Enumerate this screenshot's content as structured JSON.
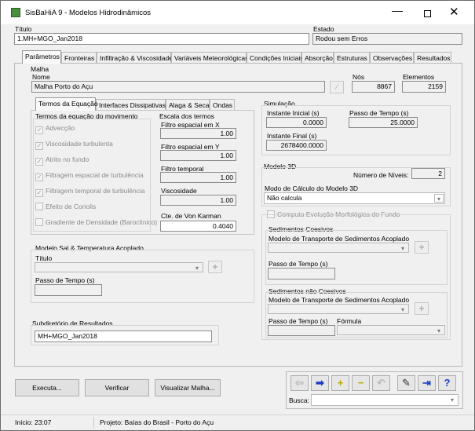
{
  "window": {
    "title": "SisBaHiA 9 - Modelos Hidrodinâmicos"
  },
  "header": {
    "titulo_label": "Título",
    "titulo_value": "1.MH+MGO_Jan2018",
    "estado_label": "Estado",
    "estado_value": "Rodou sem Erros"
  },
  "tabs": [
    "Parâmetros",
    "Fronteiras",
    "Infiltração & Viscosidade",
    "Variáveis Meteorológicas",
    "Condições Iniciais",
    "Absorção",
    "Estruturas",
    "Observações",
    "Resultados"
  ],
  "malha": {
    "group_label": "Malha",
    "nome_label": "Nome",
    "nome_value": "Malha Porto do Açu",
    "nos_label": "Nós",
    "nos_value": "8867",
    "elementos_label": "Elementos",
    "elementos_value": "2159"
  },
  "subtabs": [
    "Termos da Equação",
    "Interfaces Dissipativas",
    "Alaga & Seca",
    "Ondas"
  ],
  "termos": {
    "group_label": "Termos da equação do movimento",
    "items": [
      "Advecção",
      "Viscosidade turbulenta",
      "Atrito no fundo",
      "Filtragem espacial de turbulência",
      "Filtragem temporal de turbulência",
      "Efeito de Coriolis",
      "Gradiente de Densidade (Baroclínico)"
    ],
    "checked": [
      true,
      true,
      true,
      true,
      true,
      false,
      false
    ]
  },
  "escala": {
    "group_label": "Escala dos termos",
    "filtro_x_label": "Filtro espacial em X",
    "filtro_x": "1.00",
    "filtro_y_label": "Filtro espacial em Y",
    "filtro_y": "1.00",
    "filtro_t_label": "Filtro temporal",
    "filtro_t": "1.00",
    "visc_label": "Viscosidade",
    "visc": "1.00",
    "karman_label": "Cte. de Von Karman",
    "karman": "0.4040"
  },
  "sal": {
    "group_label": "Modelo Sal & Temperatura Acoplado",
    "titulo_label": "Título",
    "passo_label": "Passo de Tempo (s)"
  },
  "subdir": {
    "label": "Subdiretório de Resultados",
    "value": "MH+MGO_Jan2018"
  },
  "simulacao": {
    "group_label": "Simulação",
    "inicial_label": "Instante Inicial (s)",
    "inicial": "0.0000",
    "passo_label": "Passo de Tempo (s)",
    "passo": "25.0000",
    "final_label": "Instante Final (s)",
    "final": "2678400.0000"
  },
  "modelo3d": {
    "group_label": "Modelo 3D",
    "niveis_label": "Número de Níveis:",
    "niveis": "2",
    "modo_label": "Modo de Cálculo do Modelo 3D",
    "modo_value": "Não calcula"
  },
  "morfo": {
    "check_label": "Computa Evolução Morfológica do Fundo",
    "coesivos_label": "Sedimentos Coesivos",
    "modelo_label": "Modelo de Transporte de Sedimentos Acoplado",
    "passo_label": "Passo de Tempo (s)",
    "nao_coesivos_label": "Sedimentos não Coesivos",
    "modelo2_label": "Modelo de Transporte de Sedimentos Acoplado",
    "passo2_label": "Passo de Tempo (s)",
    "formula_label": "Fórmula"
  },
  "buttons": {
    "executa": "Executa...",
    "verificar": "Verificar",
    "visualizar": "Visualizar Malha..."
  },
  "nav": {
    "busca_label": "Busca:"
  },
  "status": {
    "inicio": "Início: 23:07",
    "projeto": "Projeto: Baías do Brasil - Porto do Açu"
  },
  "colors": {
    "accent": "#0066cc",
    "nav_blue": "#1c3fc8",
    "nav_yellow": "#d8c800"
  }
}
